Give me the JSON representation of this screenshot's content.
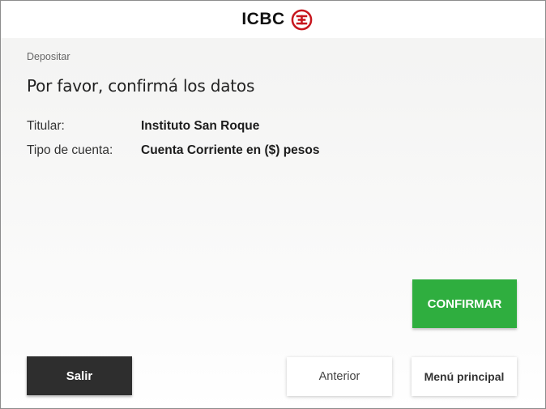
{
  "header": {
    "brand": "ICBC",
    "logo_icon": "icbc-emblem-icon",
    "brand_color": "#c7161e"
  },
  "breadcrumb": "Depositar",
  "title": "Por favor, confirmá los datos",
  "details": [
    {
      "label": "Titular:",
      "value": "Instituto San Roque"
    },
    {
      "label": "Tipo de cuenta:",
      "value": "Cuenta Corriente en ($) pesos"
    }
  ],
  "buttons": {
    "confirm": "CONFIRMAR",
    "exit": "Salir",
    "previous": "Anterior",
    "main_menu": "Menú principal"
  },
  "colors": {
    "confirm_bg": "#2fae3f",
    "exit_bg": "#2e2e2e",
    "secondary_bg": "#ffffff"
  }
}
